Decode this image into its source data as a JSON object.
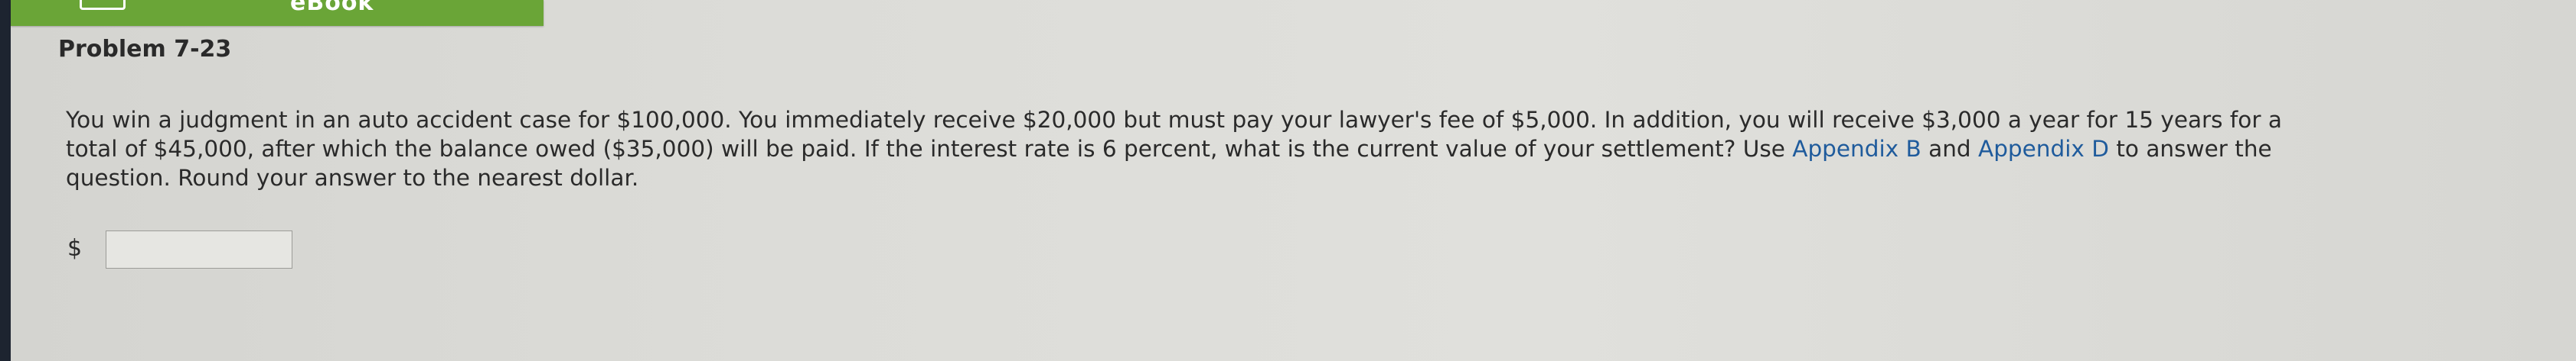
{
  "header": {
    "ebook_label": "eBook"
  },
  "problem": {
    "title": "Problem 7-23",
    "line1": "You win a judgment in an auto accident case for $100,000. You immediately receive $20,000 but must pay your lawyer's fee of $5,000. In addition, you will receive $3,000 a year for 15 years for a",
    "line2_pre": "total of $45,000, after which the balance owed ($35,000) will be paid. If the interest rate is 6 percent, what is the current value of your settlement? Use ",
    "appendix_b": "Appendix B",
    "and_text": " and ",
    "appendix_d": "Appendix D",
    "line2_post": " to answer the",
    "line3": "question. Round your answer to the nearest dollar."
  },
  "answer": {
    "currency_symbol": "$",
    "value": ""
  },
  "colors": {
    "ebook_bar": "#6aa537",
    "link": "#1f5b9c",
    "text": "#2a2a2a"
  }
}
